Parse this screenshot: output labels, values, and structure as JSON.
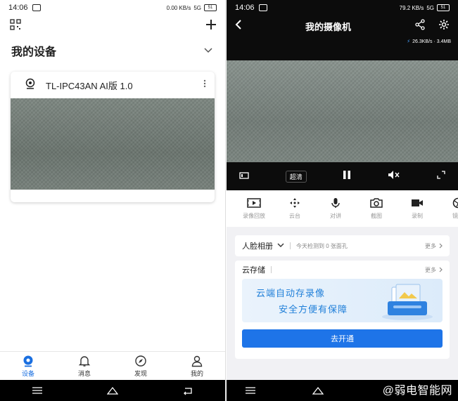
{
  "left": {
    "status": {
      "time": "14:06",
      "net": "0.00 KB/s",
      "sig": "5G",
      "battery": "51"
    },
    "title": "我的设备",
    "device": {
      "name": "TL-IPC43AN AI版 1.0"
    },
    "tabs": [
      {
        "label": "设备",
        "icon": "device-icon",
        "active": true
      },
      {
        "label": "消息",
        "icon": "bell-icon"
      },
      {
        "label": "发现",
        "icon": "compass-icon"
      },
      {
        "label": "我的",
        "icon": "profile-icon"
      }
    ]
  },
  "right": {
    "status": {
      "time": "14:06",
      "net": "79.2 KB/s",
      "sig": "5G",
      "battery": "51"
    },
    "title": "我的摄像机",
    "speed": "26.3KB/s · 3.4MB",
    "quality": "超清",
    "tools": [
      {
        "label": "录像回放",
        "icon": "playback-icon"
      },
      {
        "label": "云台",
        "icon": "ptz-icon"
      },
      {
        "label": "对讲",
        "icon": "mic-icon"
      },
      {
        "label": "截图",
        "icon": "camera-icon"
      },
      {
        "label": "录制",
        "icon": "record-icon"
      },
      {
        "label": "镜头",
        "icon": "lens-icon"
      }
    ],
    "face": {
      "title": "人脸相册",
      "desc": "今天检测到 0 张面孔",
      "more": "更多"
    },
    "cloud": {
      "title": "云存储",
      "more": "更多",
      "banner_line1": "云端自动存录像",
      "banner_line2": "安全方便有保障",
      "button": "去开通"
    },
    "watermark": "@弱电智能网"
  }
}
